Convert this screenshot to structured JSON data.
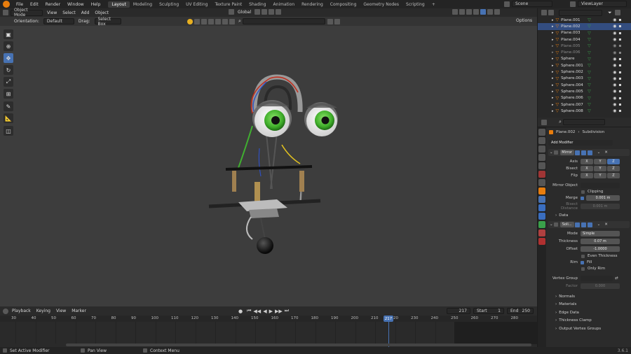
{
  "app": {
    "menus": [
      "File",
      "Edit",
      "Render",
      "Window",
      "Help"
    ],
    "workspaces": [
      "Layout",
      "Modeling",
      "Sculpting",
      "UV Editing",
      "Texture Paint",
      "Shading",
      "Animation",
      "Rendering",
      "Compositing",
      "Geometry Nodes",
      "Scripting"
    ],
    "active_workspace": "Layout",
    "scene": "Scene",
    "view_layer": "ViewLayer",
    "add_tab": "+"
  },
  "viewport": {
    "mode": "Object Mode",
    "menus": [
      "View",
      "Select",
      "Add",
      "Object"
    ],
    "transform": "Global",
    "orientation_label": "Orientation:",
    "orientation_value": "Default",
    "drag_label": "Drag:",
    "drag_value": "Select Box",
    "options": "Options"
  },
  "outliner": {
    "items": [
      {
        "name": "Plane.001",
        "selected": false,
        "dim": false
      },
      {
        "name": "Plane.002",
        "selected": true,
        "dim": false
      },
      {
        "name": "Plane.003",
        "selected": false,
        "dim": false
      },
      {
        "name": "Plane.004",
        "selected": false,
        "dim": false
      },
      {
        "name": "Plane.005",
        "selected": false,
        "dim": true
      },
      {
        "name": "Plane.006",
        "selected": false,
        "dim": true
      },
      {
        "name": "Sphere",
        "selected": false,
        "dim": false
      },
      {
        "name": "Sphere.001",
        "selected": false,
        "dim": false
      },
      {
        "name": "Sphere.002",
        "selected": false,
        "dim": false
      },
      {
        "name": "Sphere.003",
        "selected": false,
        "dim": false
      },
      {
        "name": "Sphere.004",
        "selected": false,
        "dim": false
      },
      {
        "name": "Sphere.005",
        "selected": false,
        "dim": false
      },
      {
        "name": "Sphere.006",
        "selected": false,
        "dim": false
      },
      {
        "name": "Sphere.007",
        "selected": false,
        "dim": false
      },
      {
        "name": "Sphere.008",
        "selected": false,
        "dim": false
      }
    ]
  },
  "properties": {
    "object": "Plane.002",
    "modifier_context": "Subdivision",
    "add_modifier": "Add Modifier",
    "mirror": {
      "name": "Mirror",
      "axis_label": "Axis",
      "bisect_label": "Bisect",
      "flip_label": "Flip",
      "x": "X",
      "y": "Y",
      "z": "Z",
      "mirror_object_label": "Mirror Object",
      "clipping": "Clipping",
      "merge_label": "Merge",
      "merge_value": "0.001 m",
      "bisect_distance_label": "Bisect Distance",
      "bisect_distance_value": "0.001 m",
      "data": "Data"
    },
    "solidify": {
      "name": "Soli...",
      "mode_label": "Mode",
      "mode_value": "Simple",
      "thickness_label": "Thickness",
      "thickness_value": "0.07 m",
      "offset_label": "Offset",
      "offset_value": "-1.0000",
      "even_thickness": "Even Thickness",
      "rim_label": "Rim",
      "fill": "Fill",
      "only_rim": "Only Rim",
      "vertex_group_label": "Vertex Group",
      "factor_label": "Factor",
      "factor_value": "0.000",
      "sections": [
        "Normals",
        "Materials",
        "Edge Data",
        "Thickness Clamp",
        "Output Vertex Groups"
      ]
    }
  },
  "timeline": {
    "menus": [
      "Playback",
      "Keying",
      "View",
      "Marker"
    ],
    "current_frame": "217",
    "start_label": "Start",
    "start_value": "1",
    "end_label": "End",
    "end_value": "250",
    "ticks": [
      "30",
      "40",
      "50",
      "60",
      "70",
      "80",
      "90",
      "100",
      "110",
      "120",
      "130",
      "140",
      "150",
      "160",
      "170",
      "180",
      "190",
      "200",
      "210",
      "217",
      "220",
      "230",
      "240",
      "250",
      "260",
      "270",
      "280"
    ]
  },
  "statusbar": {
    "items": [
      "Set Active Modifier",
      "Pan View",
      "Context Menu"
    ],
    "version": "3.6.1"
  },
  "colors": {
    "accent": "#4772b3",
    "eye_iris": "#3fae2a",
    "orange": "#e87d0d"
  }
}
